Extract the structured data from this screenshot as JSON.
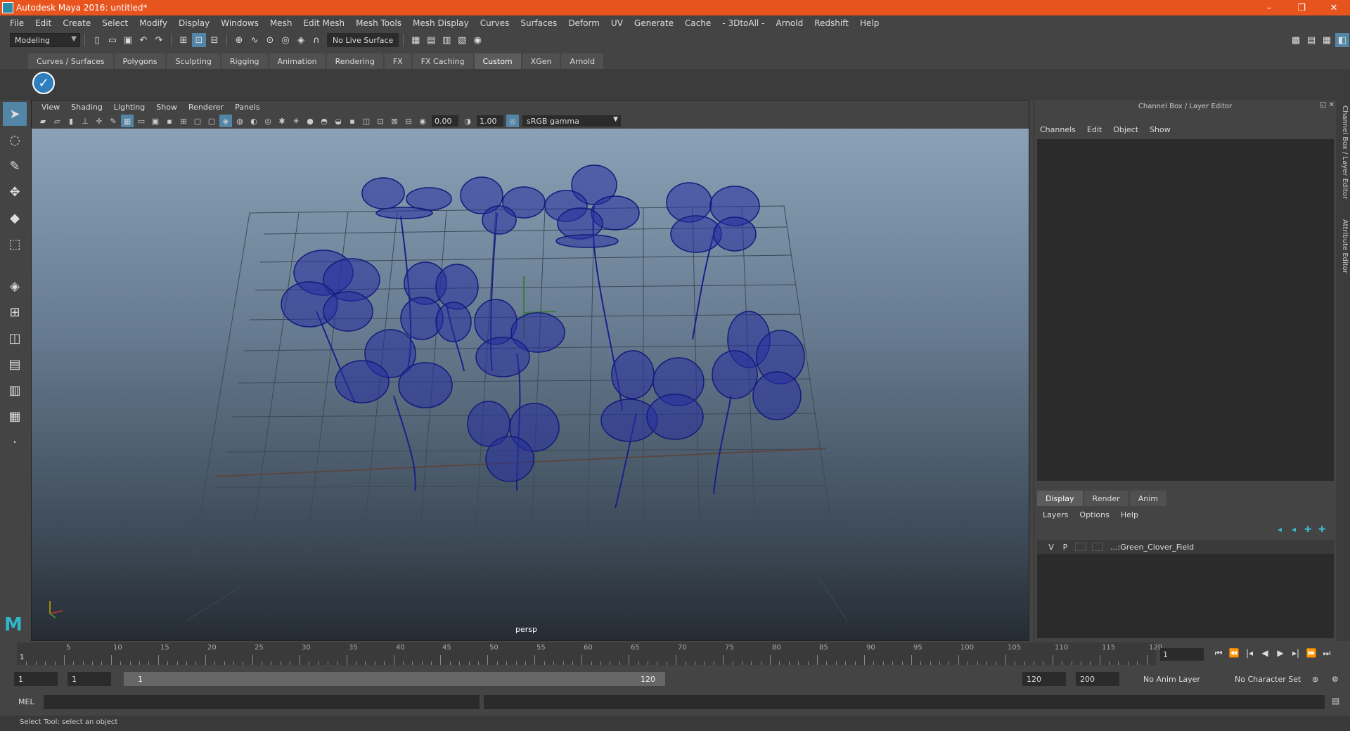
{
  "window": {
    "title": "Autodesk Maya 2016: untitled*",
    "controls": [
      "–",
      "❐",
      "✕"
    ]
  },
  "menus": [
    "File",
    "Edit",
    "Create",
    "Select",
    "Modify",
    "Display",
    "Windows",
    "Mesh",
    "Edit Mesh",
    "Mesh Tools",
    "Mesh Display",
    "Curves",
    "Surfaces",
    "Deform",
    "UV",
    "Generate",
    "Cache",
    "- 3DtoAll -",
    "Arnold",
    "Redshift",
    "Help"
  ],
  "statusline": {
    "mode": "Modeling",
    "live_surface": "No Live Surface"
  },
  "shelf": {
    "tabs": [
      "Curves / Surfaces",
      "Polygons",
      "Sculpting",
      "Rigging",
      "Animation",
      "Rendering",
      "FX",
      "FX Caching",
      "Custom",
      "XGen",
      "Arnold"
    ],
    "active_tab": "Custom"
  },
  "viewport": {
    "menus": [
      "View",
      "Shading",
      "Lighting",
      "Show",
      "Renderer",
      "Panels"
    ],
    "exposure": "0.00",
    "gamma_value": "1.00",
    "color_space": "sRGB gamma",
    "camera": "persp"
  },
  "channel_box": {
    "title": "Channel Box / Layer Editor",
    "menus": [
      "Channels",
      "Edit",
      "Object",
      "Show"
    ],
    "layer_tabs": [
      "Display",
      "Render",
      "Anim"
    ],
    "active_layer_tab": "Display",
    "layer_menus": [
      "Layers",
      "Options",
      "Help"
    ],
    "layers": [
      {
        "v": "V",
        "p": "P",
        "name": "...:Green_Clover_Field"
      }
    ]
  },
  "side_tabs": [
    "Channel Box / Layer Editor",
    "Attribute Editor"
  ],
  "timeline": {
    "labels": [
      "5",
      "10",
      "15",
      "20",
      "25",
      "30",
      "35",
      "40",
      "45",
      "50",
      "55",
      "60",
      "65",
      "70",
      "75",
      "80",
      "85",
      "90",
      "95",
      "100",
      "105",
      "110",
      "115",
      "120"
    ],
    "current_frame_marker": "1",
    "current_frame": "1"
  },
  "range": {
    "start": "1",
    "playback_start": "1",
    "bar_start": "1",
    "bar_end": "120",
    "playback_end": "120",
    "end": "200",
    "anim_layer": "No Anim Layer",
    "character_set": "No Character Set"
  },
  "command_line": {
    "label": "MEL"
  },
  "help_line": "Select Tool: select an object",
  "colors": {
    "title_bar": "#e8541e",
    "wireframe": "#1a1f8a",
    "accent": "#5285a6"
  }
}
